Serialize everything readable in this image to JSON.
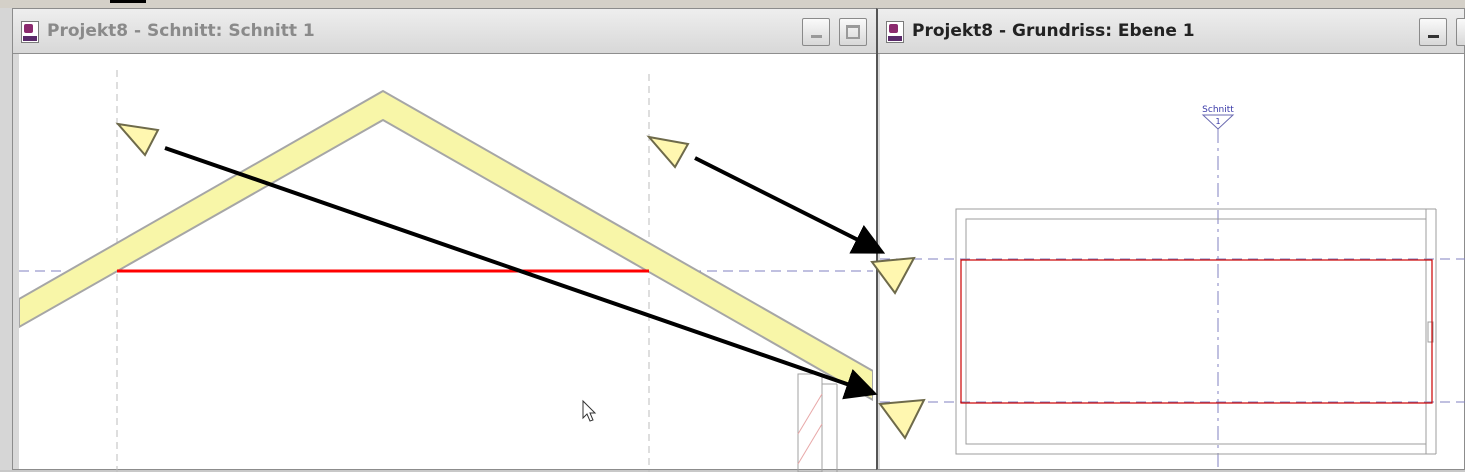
{
  "windows": {
    "section": {
      "title": "Projekt8 - Schnitt: Schnitt 1",
      "active": false
    },
    "plan": {
      "title": "Projekt8 - Grundriss: Ebene 1",
      "active": true,
      "section_tag": {
        "name": "Schnitt",
        "number": "1"
      }
    }
  },
  "colors": {
    "roof_fill": "#f8f6a8",
    "roof_edge": "#a6a6a6",
    "section_line": "#ff0000",
    "wall_outline": "#cc0000",
    "reference_line": "#8080c0",
    "annotation_arrow": "#000000",
    "pointer_fill": "#fff7b0",
    "pointer_stroke": "#6e6a4a"
  },
  "icons": {
    "app": "revit-app-icon",
    "minimize": "minimize-icon",
    "maximize": "maximize-icon",
    "cursor": "mouse-cursor-icon",
    "pointer": "view-pointer-icon"
  }
}
